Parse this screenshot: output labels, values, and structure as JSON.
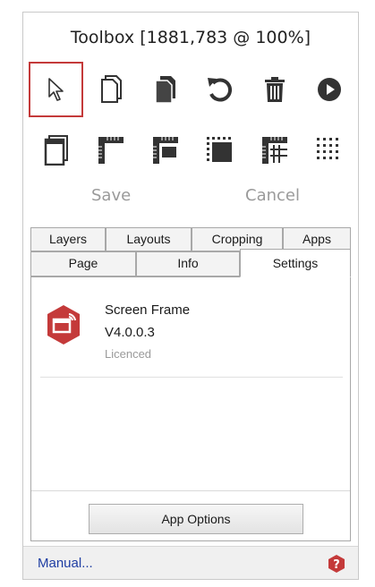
{
  "window": {
    "title": "Toolbox [1881,783 @ 100%]"
  },
  "tools": {
    "row1": [
      {
        "icon": "pointer-icon",
        "selected": true
      },
      {
        "icon": "copy-outline-icon"
      },
      {
        "icon": "copy-filled-icon"
      },
      {
        "icon": "rotate-icon"
      },
      {
        "icon": "trash-icon"
      },
      {
        "icon": "play-icon"
      }
    ],
    "row2": [
      {
        "icon": "frame-stack-icon"
      },
      {
        "icon": "ruler-corner-icon"
      },
      {
        "icon": "ruler-block-icon"
      },
      {
        "icon": "dotted-block-icon"
      },
      {
        "icon": "ruler-grid-icon"
      },
      {
        "icon": "dot-grid-icon"
      }
    ]
  },
  "actions": {
    "save_label": "Save",
    "cancel_label": "Cancel"
  },
  "tabs": {
    "row1": [
      "Layers",
      "Layouts",
      "Cropping",
      "Apps"
    ],
    "row2": [
      "Page",
      "Info",
      "Settings"
    ],
    "active": "Settings"
  },
  "app": {
    "name": "Screen Frame",
    "version": "V4.0.0.3",
    "status": "Licenced"
  },
  "buttons": {
    "app_options": "App Options"
  },
  "statusbar": {
    "manual_link": "Manual..."
  },
  "colors": {
    "accent_red": "#c43a3a",
    "link_blue": "#1f3ea3"
  }
}
